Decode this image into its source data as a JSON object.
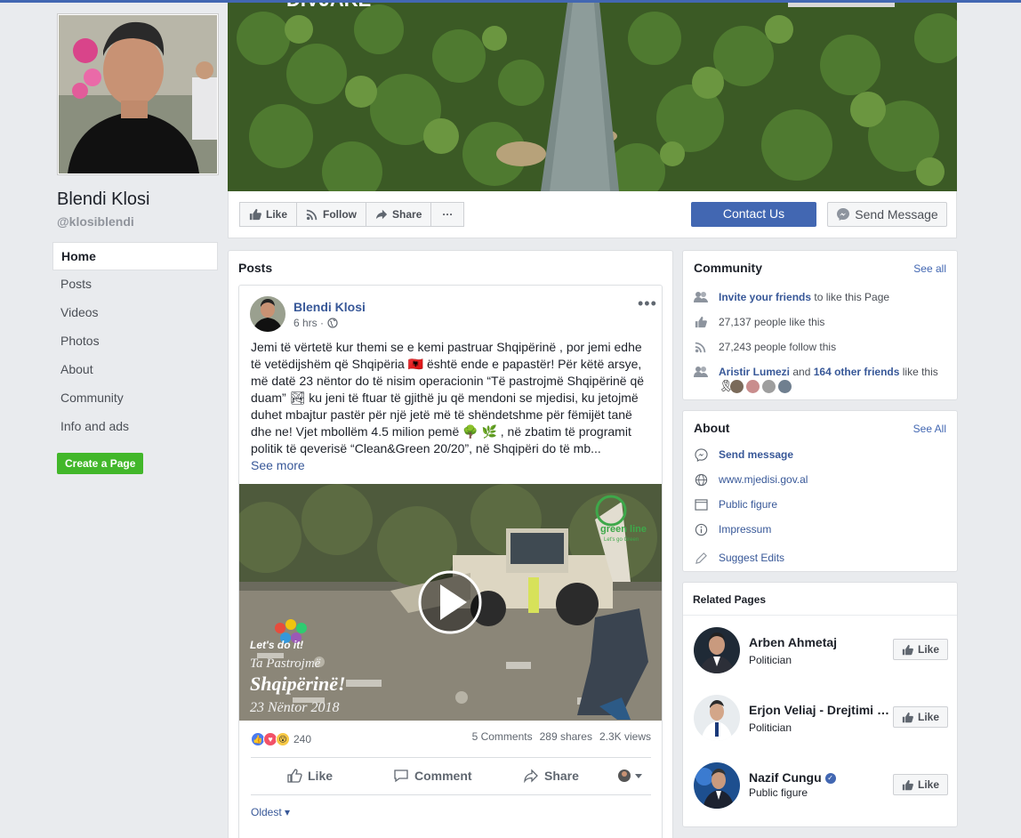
{
  "page": {
    "name": "Blendi Klosi",
    "handle": "@klosiblendi"
  },
  "nav": {
    "items": [
      {
        "label": "Home",
        "active": true
      },
      {
        "label": "Posts"
      },
      {
        "label": "Videos"
      },
      {
        "label": "Photos"
      },
      {
        "label": "About"
      },
      {
        "label": "Community"
      },
      {
        "label": "Info and ads"
      }
    ],
    "create_page": "Create a Page"
  },
  "cover": {
    "text": "DIVJAKE"
  },
  "actions": {
    "like": "Like",
    "follow": "Follow",
    "share": "Share",
    "more": "···",
    "contact": "Contact Us",
    "send_message": "Send Message"
  },
  "posts": {
    "title": "Posts",
    "post": {
      "author": "Blendi Klosi",
      "time": "6 hrs ·",
      "text": "Jemi të vërtetë kur themi se e kemi pastruar Shqipërinë , por jemi edhe të vetëdijshëm që Shqipëria 🇦🇱 është ende e papastër! Për këtë arsye, më datë 23 nëntor do të nisim operacionin “Të pastrojmë Shqipërinë që duam” 🏞 ku jeni të ftuar të gjithë ju që mendoni se mjedisi, ku jetojmë duhet mbajtur pastër për një jetë më të shëndetshme për fëmijët tanë dhe ne! Vjet mbollëm 4.5 milion pemë 🌳 🌿 , në zbatim të programit politik të qeverisë “Clean&Green 20/20”, në Shqipëri do të mb...",
      "see_more": "See more",
      "video_overlay": {
        "brand": "green line",
        "brand_sub": "Let's go Green",
        "lets_do_it": "Let's do it!",
        "line1": "Ta Pastrojmë",
        "line2": "Shqipërinë!",
        "line3": "23 Nëntor 2018"
      },
      "reactions": "240",
      "comments": "5 Comments",
      "shares": "289 shares",
      "views": "2.3K views",
      "like": "Like",
      "comment": "Comment",
      "share": "Share",
      "sort": "Oldest ▾"
    }
  },
  "community": {
    "title": "Community",
    "see_all": "See all",
    "invite_link": "Invite your friends",
    "invite_rest": " to like this Page",
    "likes": "27,137 people like this",
    "follows": "27,243 people follow this",
    "friend": "Aristir Lumezi",
    "and": " and ",
    "others": "164 other friends",
    "like_this": " like this"
  },
  "about": {
    "title": "About",
    "see_all": "See All",
    "send_message": "Send message",
    "website": "www.mjedisi.gov.al",
    "category": "Public figure",
    "impressum": "Impressum",
    "suggest": "Suggest Edits"
  },
  "related": {
    "title": "Related Pages",
    "items": [
      {
        "name": "Arben Ahmetaj",
        "category": "Politician",
        "like": "Like"
      },
      {
        "name": "Erjon Veliaj - Drejtimi i Ri",
        "category": "Politician",
        "like": "Like"
      },
      {
        "name": "Nazif Cungu",
        "category": "Public figure",
        "like": "Like"
      }
    ]
  },
  "colors": {
    "brand_blue": "#4267b2",
    "link": "#385898",
    "green": "#42b72a",
    "background": "#e9ebee"
  }
}
